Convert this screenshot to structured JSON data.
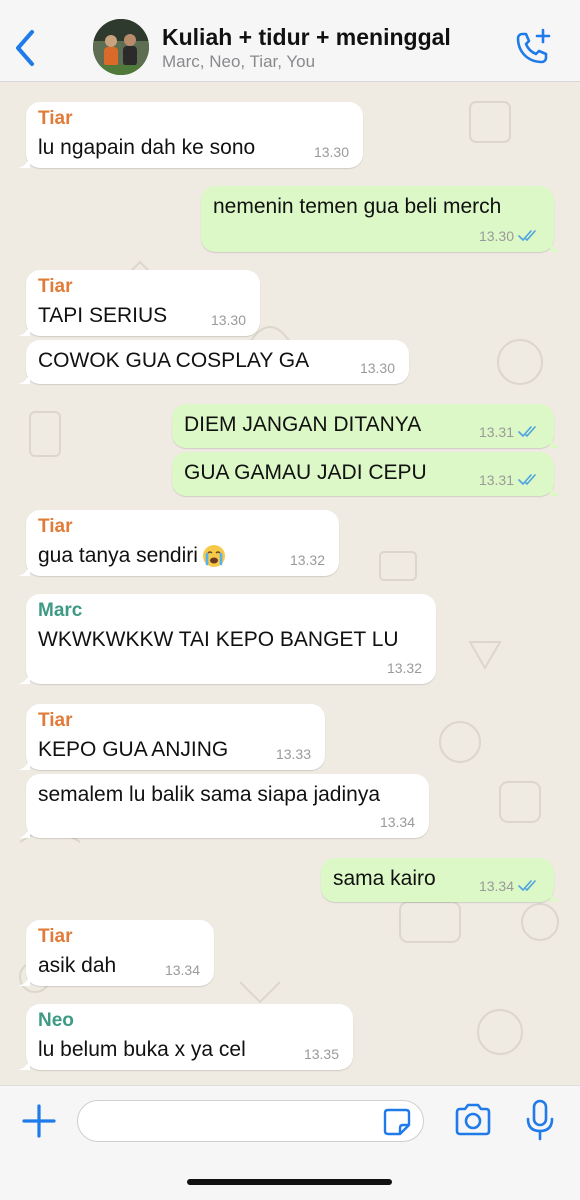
{
  "header": {
    "title": "Kuliah + tidur + meninggal",
    "participants": "Marc, Neo, Tiar, You",
    "accent_color": "#1f7aea"
  },
  "messages": [
    {
      "sender": "Tiar",
      "text": "lu ngapain dah ke sono",
      "time": "13.30",
      "direction": "incoming",
      "sender_color": "#e07b39"
    },
    {
      "sender": "",
      "text": "nemenin temen gua beli merch",
      "time": "13.30",
      "direction": "outgoing",
      "read": true
    },
    {
      "sender": "Tiar",
      "text": "TAPI SERIUS",
      "time": "13.30",
      "direction": "incoming",
      "sender_color": "#e07b39"
    },
    {
      "sender": "",
      "text": "COWOK GUA COSPLAY GA",
      "time": "13.30",
      "direction": "incoming"
    },
    {
      "sender": "",
      "text": "DIEM JANGAN DITANYA",
      "time": "13.31",
      "direction": "outgoing",
      "read": true
    },
    {
      "sender": "",
      "text": "GUA GAMAU JADI CEPU",
      "time": "13.31",
      "direction": "outgoing",
      "read": true
    },
    {
      "sender": "Tiar",
      "text": "gua tanya sendiri",
      "emoji": "loudly-crying-face",
      "time": "13.32",
      "direction": "incoming",
      "sender_color": "#e07b39"
    },
    {
      "sender": "Marc",
      "text": "WKWKWKKW TAI KEPO BANGET LU",
      "time": "13.32",
      "direction": "incoming",
      "sender_color": "#3e9a85"
    },
    {
      "sender": "Tiar",
      "text": "KEPO GUA ANJING",
      "time": "13.33",
      "direction": "incoming",
      "sender_color": "#e07b39"
    },
    {
      "sender": "",
      "text": "semalem lu balik sama siapa jadinya",
      "time": "13.34",
      "direction": "incoming"
    },
    {
      "sender": "",
      "text": "sama kairo",
      "time": "13.34",
      "direction": "outgoing",
      "read": true
    },
    {
      "sender": "Tiar",
      "text": "asik dah",
      "time": "13.34",
      "direction": "incoming",
      "sender_color": "#e07b39"
    },
    {
      "sender": "Neo",
      "text": "lu belum buka x ya cel",
      "time": "13.35",
      "direction": "incoming",
      "sender_color": "#3e9a85"
    }
  ],
  "composer": {
    "value": "",
    "icons": [
      "plus-icon",
      "sticker-icon",
      "camera-icon",
      "microphone-icon"
    ]
  },
  "colors": {
    "incoming_bubble": "#ffffff",
    "outgoing_bubble": "#dcf8c6",
    "read_ticks": "#4fa3e0",
    "chat_background": "#efeae2"
  }
}
